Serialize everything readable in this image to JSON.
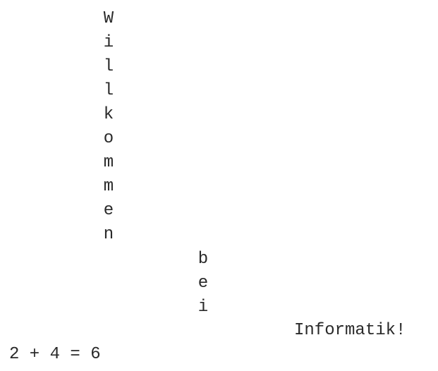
{
  "output": {
    "word1_letters": [
      "W",
      "i",
      "l",
      "l",
      "k",
      "o",
      "m",
      "m",
      "e",
      "n"
    ],
    "word2_letters": [
      "b",
      "e",
      "i"
    ],
    "word3": "Informatik!",
    "equation": "2 + 4 = 6"
  }
}
